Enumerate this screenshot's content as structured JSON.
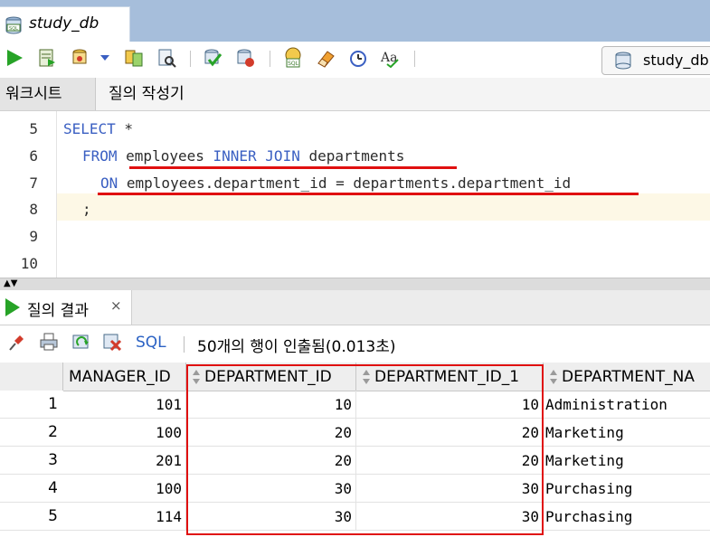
{
  "file_tab": {
    "title": "study_db"
  },
  "toolbar": {
    "icons": [
      "run-statement-icon",
      "run-script-icon",
      "autotrace-icon",
      "dropdown-arrow-icon",
      "explain-plan-icon",
      "sql-tuning-icon",
      "commit-icon",
      "rollback-icon",
      "unshared-sql-icon",
      "clear-icon",
      "history-icon",
      "change-case-icon"
    ],
    "connection_label": "study_db"
  },
  "subtabs": {
    "worksheet": "워크시트",
    "query_builder": "질의 작성기"
  },
  "editor": {
    "line_numbers": [
      "5",
      "6",
      "7",
      "8",
      "9",
      "10"
    ],
    "lines": {
      "l5": {
        "kw1": "SELECT",
        "rest": " *"
      },
      "l6": {
        "kw1": "FROM",
        "t1": " employees ",
        "kw2": "INNER JOIN",
        "t2": " departments"
      },
      "l7": {
        "kw1": "ON",
        "t1": " employees.department_id = departments.department_id"
      },
      "l8": {
        "t1": ";"
      }
    }
  },
  "results": {
    "tab_label": "질의 결과",
    "close_label": "×",
    "sql_link": "SQL",
    "status": "50개의 행이 인출됨(0.013초)",
    "columns": [
      "MANAGER_ID",
      "DEPARTMENT_ID",
      "DEPARTMENT_ID_1",
      "DEPARTMENT_NA"
    ],
    "rows": [
      {
        "num": "1",
        "manager_id": "101",
        "department_id": "10",
        "department_id_1": "10",
        "department_name": "Administration"
      },
      {
        "num": "2",
        "manager_id": "100",
        "department_id": "20",
        "department_id_1": "20",
        "department_name": "Marketing"
      },
      {
        "num": "3",
        "manager_id": "201",
        "department_id": "20",
        "department_id_1": "20",
        "department_name": "Marketing"
      },
      {
        "num": "4",
        "manager_id": "100",
        "department_id": "30",
        "department_id_1": "30",
        "department_name": "Purchasing"
      },
      {
        "num": "5",
        "manager_id": "114",
        "department_id": "30",
        "department_id_1": "30",
        "department_name": "Purchasing"
      }
    ]
  },
  "colors": {
    "tab_strip": "#a6bedb",
    "keyword": "#3a5fc2",
    "annotation_red": "#e01010",
    "run_green": "#27a327"
  }
}
